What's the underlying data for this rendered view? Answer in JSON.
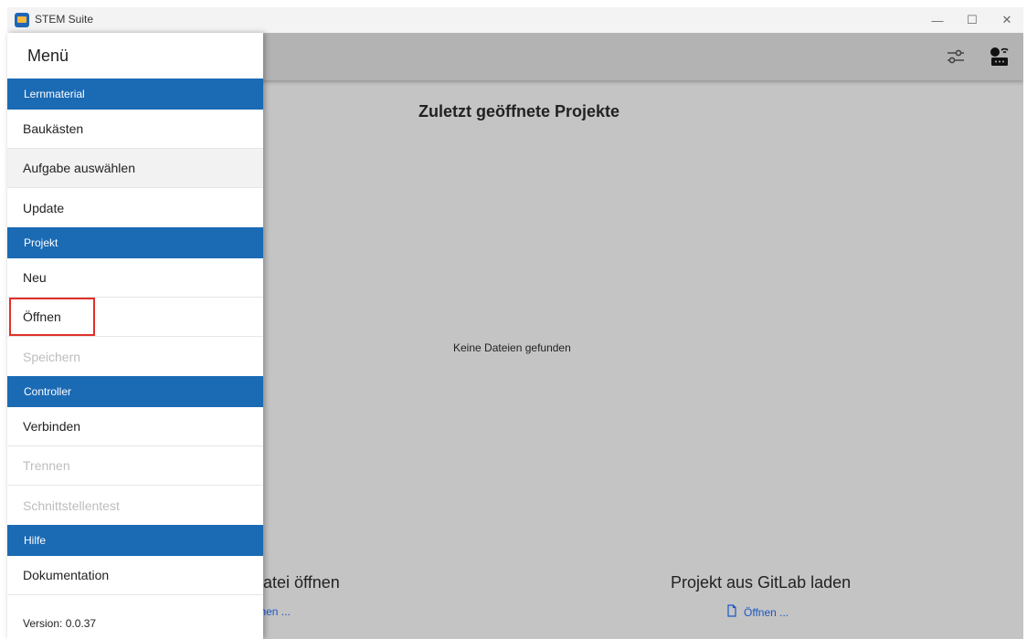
{
  "window": {
    "title": "STEM Suite",
    "minimize": "—",
    "maximize": "☐",
    "close": "✕"
  },
  "drawer": {
    "title": "Menü",
    "sections": {
      "lernmaterial": "Lernmaterial",
      "projekt": "Projekt",
      "controller": "Controller",
      "hilfe": "Hilfe"
    },
    "items": {
      "baukaesten": "Baukästen",
      "aufgabe": "Aufgabe auswählen",
      "update": "Update",
      "neu": "Neu",
      "oeffnen": "Öffnen",
      "speichern": "Speichern",
      "verbinden": "Verbinden",
      "trennen": "Trennen",
      "schnittstellentest": "Schnittstellentest",
      "dokumentation": "Dokumentation"
    },
    "version": "Version: 0.0.37"
  },
  "main": {
    "recent_title": "Zuletzt geöffnete Projekte",
    "no_files": "Keine Dateien gefunden",
    "file_open": {
      "title": "atei öffnen",
      "link": "ffnen ..."
    },
    "gitlab": {
      "title": "Projekt aus GitLab laden",
      "link": "Öffnen ..."
    }
  },
  "colors": {
    "accent": "#1b6ab4",
    "link": "#1a56c5",
    "highlight": "#e0302a"
  }
}
